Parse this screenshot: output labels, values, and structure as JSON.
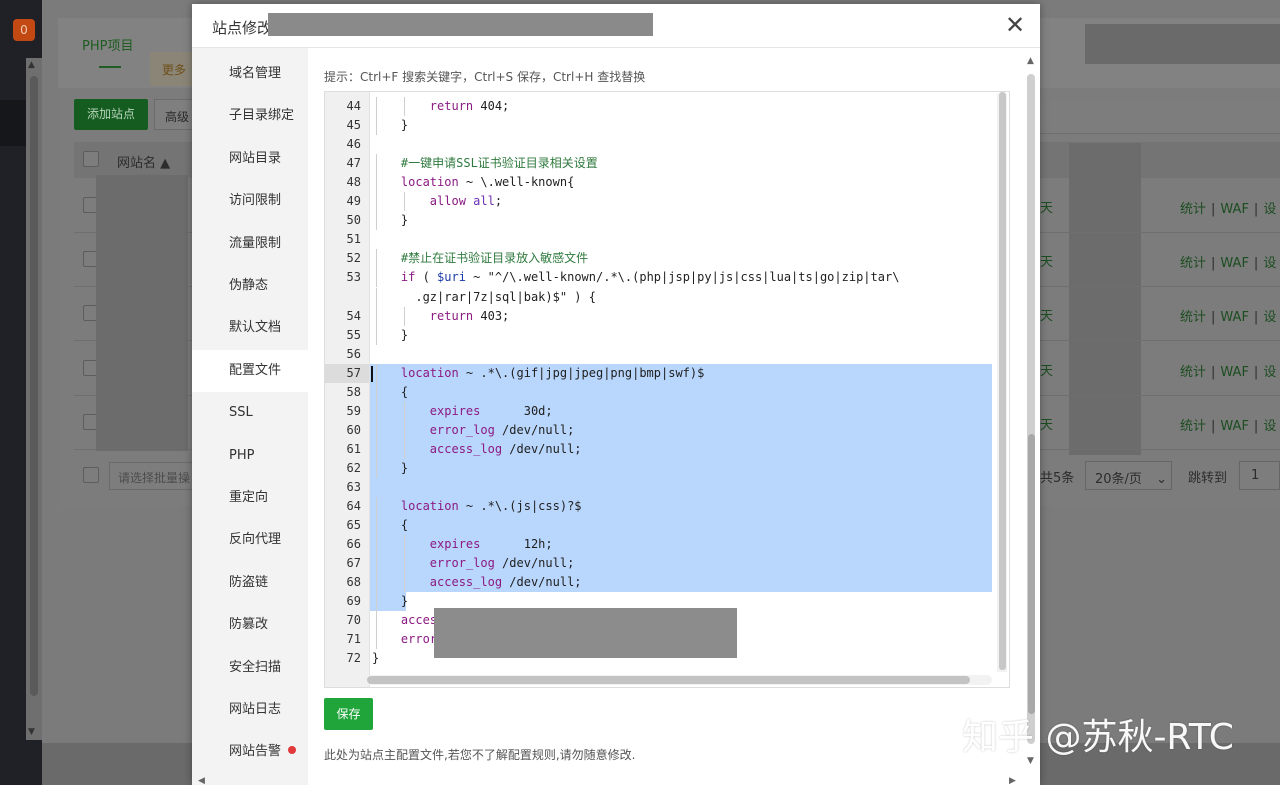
{
  "background": {
    "badge_count": "0",
    "tab_php": "PHP项目",
    "more_label": "更多",
    "add_site_button": "添加站点",
    "advanced_button": "高级",
    "table_header_site": "网站名 ▲",
    "batch_placeholder": "请选择批量操",
    "day_label": "天",
    "ops": {
      "stats": "统计",
      "waf": "WAF",
      "settings": "设"
    },
    "total": "共5条",
    "page_size": "20条/页",
    "jump_label": "跳转到",
    "jump_value": "1"
  },
  "modal": {
    "title": "站点修改",
    "close_glyph": "✕",
    "nav": [
      {
        "label": "域名管理"
      },
      {
        "label": "子目录绑定"
      },
      {
        "label": "网站目录"
      },
      {
        "label": "访问限制"
      },
      {
        "label": "流量限制"
      },
      {
        "label": "伪静态"
      },
      {
        "label": "默认文档"
      },
      {
        "label": "配置文件"
      },
      {
        "label": "SSL"
      },
      {
        "label": "PHP"
      },
      {
        "label": "重定向"
      },
      {
        "label": "反向代理"
      },
      {
        "label": "防盗链"
      },
      {
        "label": "防篡改"
      },
      {
        "label": "安全扫描"
      },
      {
        "label": "网站日志"
      },
      {
        "label": "网站告警"
      }
    ],
    "active_nav": "配置文件",
    "hint": "提示：Ctrl+F 搜索关键字，Ctrl+S 保存，Ctrl+H 查找替换",
    "save_button": "保存",
    "note": "此处为站点主配置文件,若您不了解配置规则,请勿随意修改.",
    "editor": {
      "active_line": "57",
      "lines": [
        {
          "n": "44",
          "code": "        return 404;"
        },
        {
          "n": "45",
          "code": "    }"
        },
        {
          "n": "46",
          "code": ""
        },
        {
          "n": "47",
          "code": "    #一键申请SSL证书验证目录相关设置"
        },
        {
          "n": "48",
          "code": "    location ~ \\.well-known{"
        },
        {
          "n": "49",
          "code": "        allow all;"
        },
        {
          "n": "50",
          "code": "    }"
        },
        {
          "n": "51",
          "code": ""
        },
        {
          "n": "52",
          "code": "    #禁止在证书验证目录放入敏感文件"
        },
        {
          "n": "53",
          "code": "    if ( $uri ~ \"^/\\.well-known/.*\\.(php|jsp|py|js|css|lua|ts|go|zip|tar\\"
        },
        {
          "n": "",
          "code": "      .gz|rar|7z|sql|bak)$\" ) {"
        },
        {
          "n": "54",
          "code": "        return 403;"
        },
        {
          "n": "55",
          "code": "    }"
        },
        {
          "n": "56",
          "code": ""
        },
        {
          "n": "57",
          "code": "    location ~ .*\\.(gif|jpg|jpeg|png|bmp|swf)$"
        },
        {
          "n": "58",
          "code": "    {"
        },
        {
          "n": "59",
          "code": "        expires      30d;"
        },
        {
          "n": "60",
          "code": "        error_log /dev/null;"
        },
        {
          "n": "61",
          "code": "        access_log /dev/null;"
        },
        {
          "n": "62",
          "code": "    }"
        },
        {
          "n": "63",
          "code": ""
        },
        {
          "n": "64",
          "code": "    location ~ .*\\.(js|css)?$"
        },
        {
          "n": "65",
          "code": "    {"
        },
        {
          "n": "66",
          "code": "        expires      12h;"
        },
        {
          "n": "67",
          "code": "        error_log /dev/null;"
        },
        {
          "n": "68",
          "code": "        access_log /dev/null;"
        },
        {
          "n": "69",
          "code": "    }"
        },
        {
          "n": "70",
          "code": "    access_log"
        },
        {
          "n": "71",
          "code": "    error_log"
        },
        {
          "n": "72",
          "code": "}"
        }
      ]
    }
  },
  "watermark": "知乎 @苏秋-RTC",
  "colors": {
    "brand_green": "#20a53a",
    "selection": "#b9d6fc",
    "keyword": "#8b1a83",
    "comment": "#2f7a3e",
    "alert_dot": "#e2393c"
  }
}
